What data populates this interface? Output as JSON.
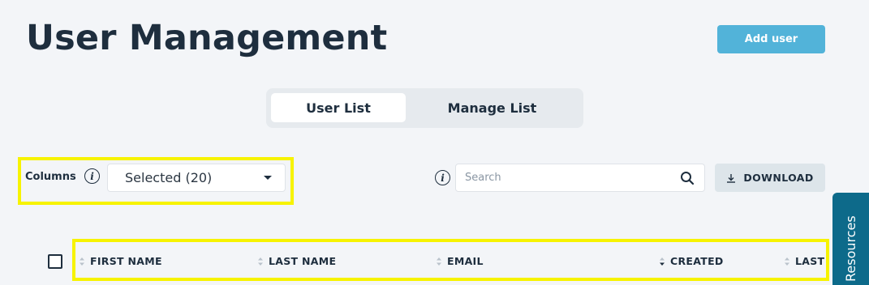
{
  "header": {
    "title": "User Management",
    "add_user_label": "Add user"
  },
  "tabs": [
    {
      "label": "User List",
      "active": true
    },
    {
      "label": "Manage List",
      "active": false
    }
  ],
  "toolbar": {
    "columns_label": "Columns",
    "columns_selected": "Selected (20)",
    "search_placeholder": "Search",
    "download_label": "DOWNLOAD"
  },
  "table": {
    "columns": [
      {
        "label": "FIRST NAME",
        "sort": "none"
      },
      {
        "label": "LAST NAME",
        "sort": "none"
      },
      {
        "label": "EMAIL",
        "sort": "none"
      },
      {
        "label": "CREATED",
        "sort": "descending"
      },
      {
        "label": "LAST",
        "sort": "none"
      }
    ]
  },
  "side_tab": {
    "label": "Resources"
  },
  "colors": {
    "accent": "#52b3d9",
    "side_tab": "#0d6a8a",
    "highlight": "#f7f300",
    "background": "#f3f5f8"
  },
  "icons": [
    "info-icon",
    "search-icon",
    "download-icon",
    "sort-icon",
    "caret-down-icon"
  ]
}
